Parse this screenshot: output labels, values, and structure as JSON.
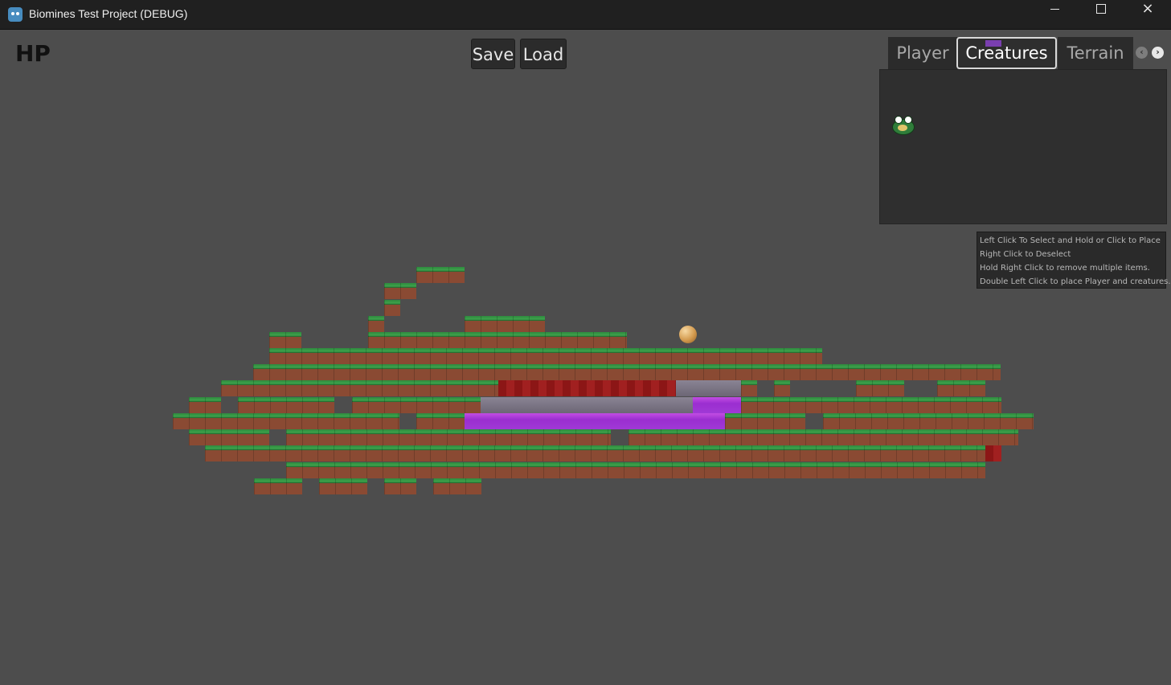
{
  "window": {
    "title": "Biomines Test Project (DEBUG)",
    "minimize_icon": "minimize-icon",
    "maximize_icon": "maximize-icon",
    "close_icon": "×"
  },
  "hud": {
    "hp_label": "HP"
  },
  "toolbar": {
    "save_label": "Save",
    "load_label": "Load"
  },
  "tabs": {
    "items": [
      {
        "label": "Player",
        "active": false
      },
      {
        "label": "Creatures",
        "active": true
      },
      {
        "label": "Terrain",
        "active": false
      }
    ],
    "prev_icon": "‹",
    "next_icon": "›"
  },
  "creatures_panel": {
    "items": [
      {
        "icon": "frog-creature-icon"
      }
    ]
  },
  "help": {
    "lines": [
      "Left Click To Select and Hold or Click to Place",
      "Right Click to Deselect",
      "Hold Right Click to remove multiple items.",
      "Double Left Click to place Player and creatures."
    ]
  },
  "colors": {
    "background": "#4d4d4d",
    "grass": "#3da24c",
    "dirt": "#8a4a33",
    "lava": "#a12020",
    "stone": "#6c6675",
    "toxic": "#a039d6"
  }
}
